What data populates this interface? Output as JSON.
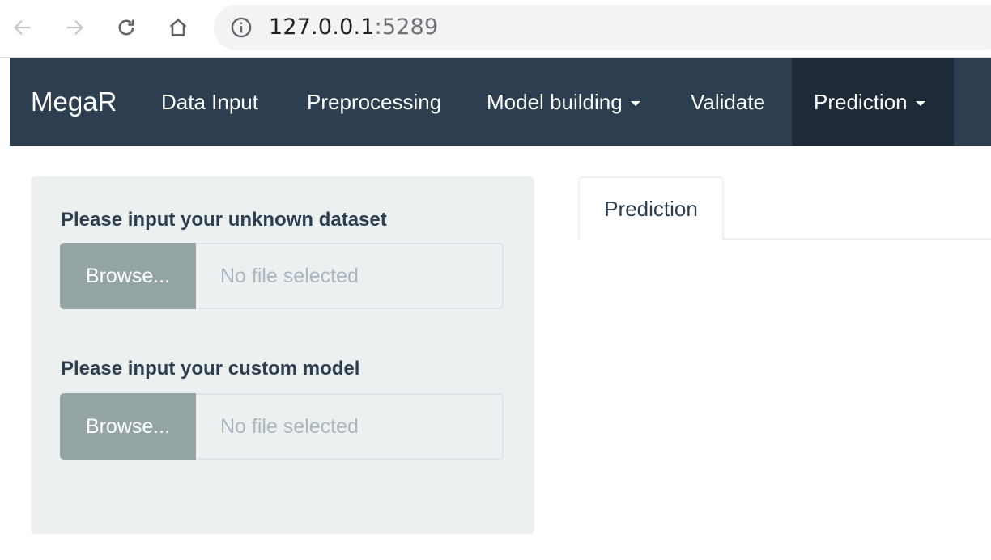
{
  "browser": {
    "url_host": "127.0.0.1",
    "url_port": ":5289",
    "icons": [
      "back-arrow-icon",
      "forward-arrow-icon",
      "reload-icon",
      "home-icon",
      "info-icon"
    ]
  },
  "navbar": {
    "brand": "MegaR",
    "items": [
      {
        "label": "Data Input",
        "dropdown": false
      },
      {
        "label": "Preprocessing",
        "dropdown": false
      },
      {
        "label": "Model building",
        "dropdown": true
      },
      {
        "label": "Validate",
        "dropdown": false
      },
      {
        "label": "Prediction",
        "dropdown": true,
        "active": true
      }
    ],
    "colors": {
      "background": "#2c3e50",
      "active": "#1e2b37"
    }
  },
  "sidebar": {
    "inputs": [
      {
        "label": "Please input your unknown dataset",
        "button": "Browse...",
        "placeholder": "No file selected"
      },
      {
        "label": "Please input your custom model",
        "button": "Browse...",
        "placeholder": "No file selected"
      }
    ]
  },
  "main": {
    "tabs": [
      {
        "label": "Prediction",
        "active": true
      }
    ]
  }
}
